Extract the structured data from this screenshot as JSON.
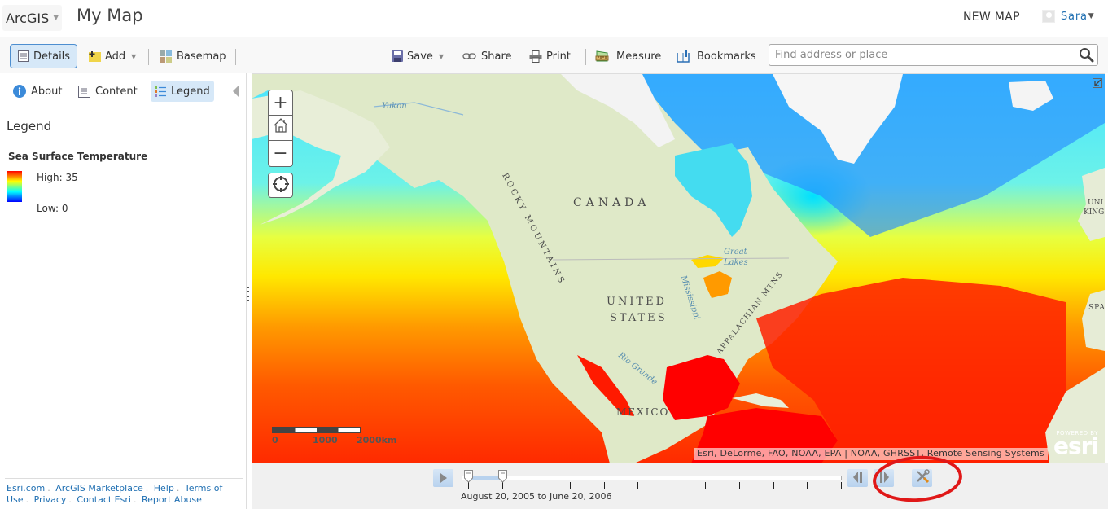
{
  "header": {
    "brand": "ArcGIS",
    "map_title": "My Map",
    "new_map": "NEW MAP",
    "user_name": "Sara"
  },
  "toolbar": {
    "details": "Details",
    "add": "Add",
    "basemap": "Basemap",
    "save": "Save",
    "share": "Share",
    "print": "Print",
    "measure": "Measure",
    "bookmarks": "Bookmarks",
    "search_placeholder": "Find address or place",
    "search_value": ""
  },
  "panel": {
    "tabs": [
      {
        "label": "About",
        "icon": "info-icon",
        "active": false
      },
      {
        "label": "Content",
        "icon": "content-list-icon",
        "active": false
      },
      {
        "label": "Legend",
        "icon": "legend-list-icon",
        "active": true
      }
    ],
    "heading": "Legend",
    "layer_title": "Sea Surface Temperature",
    "ramp_high": "High: 35",
    "ramp_low": "Low: 0",
    "ramp_colors": [
      "#ff0000",
      "#ff8000",
      "#ffff00",
      "#80ff80",
      "#00ffff",
      "#0080ff",
      "#0000ff"
    ],
    "footer_links": [
      "Esri.com",
      "ArcGIS Marketplace",
      "Help",
      "Terms of Use",
      "Privacy",
      "Contact Esri",
      "Report Abuse"
    ]
  },
  "map": {
    "labels": {
      "canada": "CANADA",
      "united": "UNITED",
      "states": "STATES",
      "mexico": "MEXICO",
      "rocky": "ROCKY MOUNTAINS",
      "appalachian": "APPALACHIAN MTNS",
      "spain": "SPAI",
      "uk1": "UNI",
      "uk2": "KING"
    },
    "water_labels": {
      "yukon": "Yukon",
      "great": "Great",
      "lakes": "Lakes",
      "mississippi": "Mississippi",
      "rio_grande": "Rio Grande"
    },
    "zoom_in": "+",
    "zoom_out": "−",
    "scale_labels": [
      "0",
      "1000",
      "2000km"
    ],
    "attribution": "Esri, DeLorme, FAO, NOAA, EPA | NOAA, GHRSST, Remote Sensing Systems",
    "logo_powered": "POWERED BY",
    "logo_word": "esri"
  },
  "time_slider": {
    "label": "August 20, 2005 to June 20, 2006",
    "tick_count": 12,
    "start_index": 0,
    "end_index": 1
  },
  "annotation": {
    "color": "#e01818"
  }
}
